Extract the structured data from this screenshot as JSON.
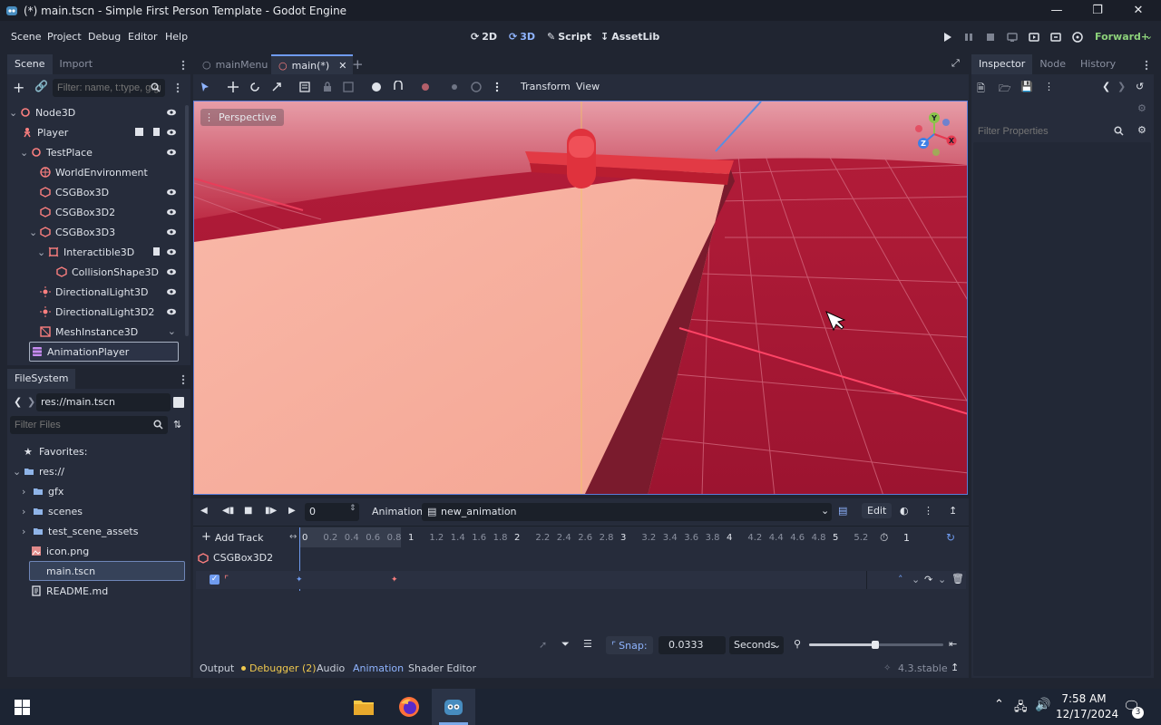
{
  "window": {
    "title": "(*) main.tscn - Simple First Person Template - Godot Engine"
  },
  "menu": {
    "items": [
      "Scene",
      "Project",
      "Debug",
      "Editor",
      "Help"
    ]
  },
  "workspaces": {
    "w2d": "2D",
    "w3d": "3D",
    "script": "Script",
    "assetlib": "AssetLib"
  },
  "renderer": "Forward+",
  "scene_dock": {
    "tabs": [
      "Scene",
      "Import"
    ],
    "filter_placeholder": "Filter: name, t:type, g:group",
    "nodes": [
      "Node3D",
      "Player",
      "TestPlace",
      "WorldEnvironment",
      "CSGBox3D",
      "CSGBox3D2",
      "CSGBox3D3",
      "Interactible3D",
      "CollisionShape3D",
      "DirectionalLight3D",
      "DirectionalLight3D2",
      "MeshInstance3D",
      "AnimationPlayer"
    ]
  },
  "filesystem": {
    "title": "FileSystem",
    "path": "res://main.tscn",
    "filter_placeholder": "Filter Files",
    "items": [
      "Favorites:",
      "res://",
      "gfx",
      "scenes",
      "test_scene_assets",
      "icon.png",
      "main.tscn",
      "README.md"
    ]
  },
  "scene_tabs": [
    "mainMenu",
    "main(*)"
  ],
  "viewport_toolbar": {
    "transform": "Transform",
    "view": "View"
  },
  "viewport": {
    "label": "Perspective",
    "gizmo": {
      "y": "Y",
      "x": "X",
      "z": "Z"
    }
  },
  "inspector": {
    "tabs": [
      "Inspector",
      "Node",
      "History"
    ],
    "filter_placeholder": "Filter Properties"
  },
  "animation": {
    "time": "0",
    "label": "Animation",
    "name": "new_animation",
    "edit": "Edit",
    "add_track": "Add Track",
    "track": "CSGBox3D2",
    "length": "1",
    "snap_label": "Snap:",
    "snap_value": "0.0333",
    "snap_unit": "Seconds",
    "ruler": [
      "0",
      "0.2",
      "0.4",
      "0.6",
      "0.8",
      "1",
      "1.2",
      "1.4",
      "1.6",
      "1.8",
      "2",
      "2.2",
      "2.4",
      "2.6",
      "2.8",
      "3",
      "3.2",
      "3.4",
      "3.6",
      "3.8",
      "4",
      "4.2",
      "4.4",
      "4.6",
      "4.8",
      "5",
      "5.2"
    ]
  },
  "bottom_tabs": [
    "Output",
    "Debugger (2)",
    "Audio",
    "Animation",
    "Shader Editor"
  ],
  "version": "4.3.stable",
  "taskbar": {
    "time": "7:58 AM",
    "date": "12/17/2024",
    "notifications": "3"
  }
}
